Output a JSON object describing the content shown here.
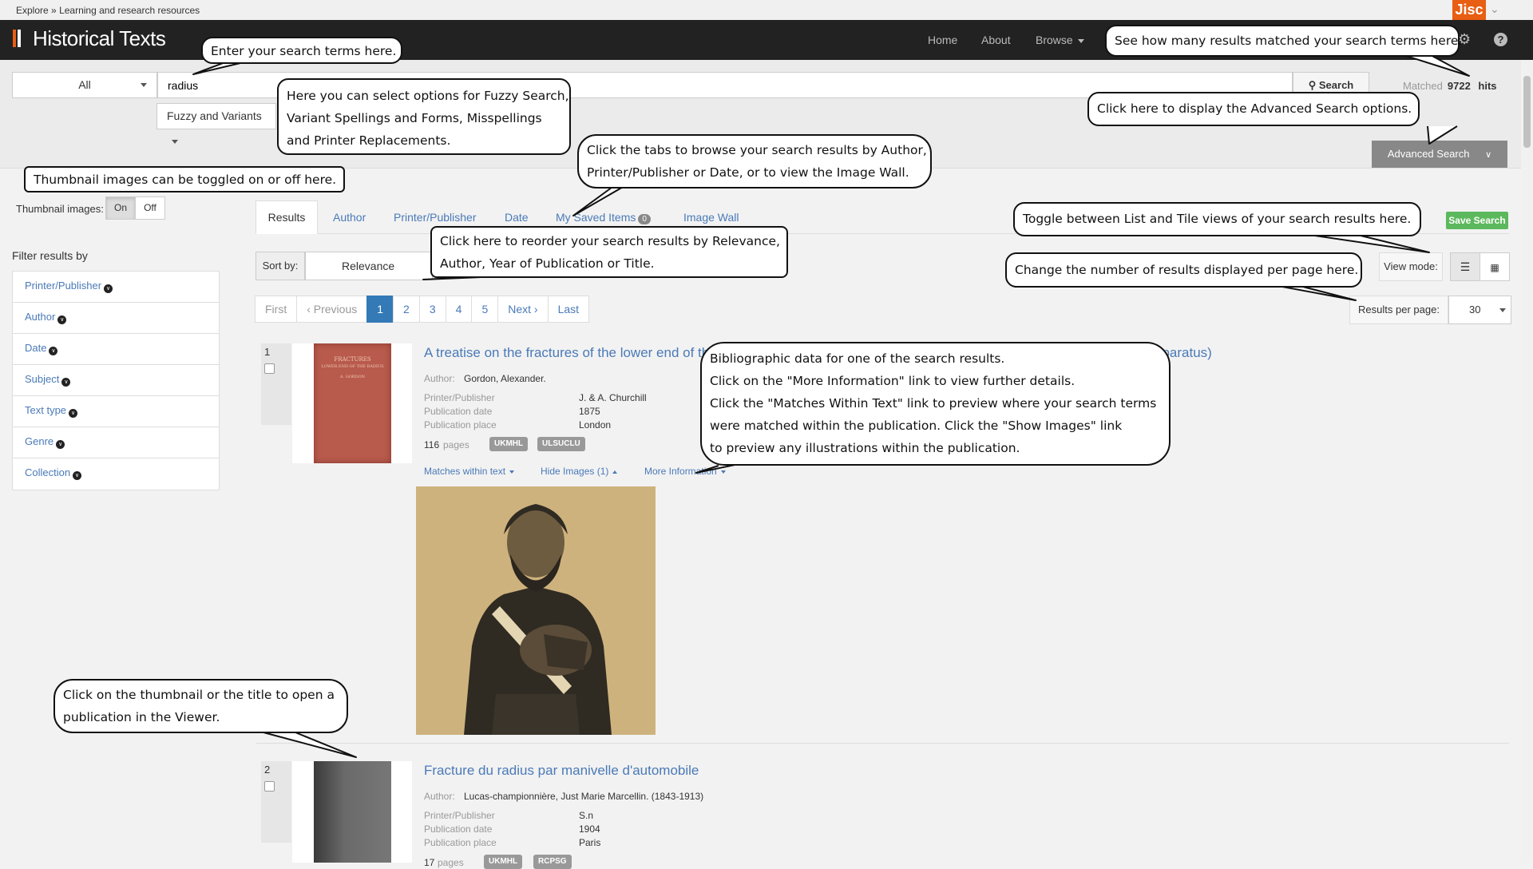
{
  "breadcrumb": {
    "explore": "Explore",
    "sep": "»",
    "current": "Learning and research resources"
  },
  "jisc": {
    "label": "Jisc"
  },
  "app": {
    "title": "Historical Texts"
  },
  "nav": {
    "home": "Home",
    "about": "About",
    "browse": "Browse"
  },
  "search": {
    "scope": "All",
    "query": "radius",
    "button": "Search",
    "fuzzy": "Fuzzy and Variants",
    "matched_label": "Matched",
    "matched_count": "9722",
    "hits_label": "hits",
    "advanced": "Advanced Search"
  },
  "thumbnails": {
    "label": "Thumbnail images:",
    "on": "On",
    "off": "Off"
  },
  "tabs": {
    "results": "Results",
    "author": "Author",
    "printer": "Printer/Publisher",
    "date": "Date",
    "saved": "My Saved Items",
    "saved_count": "0",
    "image_wall": "Image Wall"
  },
  "save_search": "Save Search",
  "filters": {
    "title": "Filter results by",
    "items": [
      {
        "label": "Printer/Publisher"
      },
      {
        "label": "Author"
      },
      {
        "label": "Date"
      },
      {
        "label": "Subject"
      },
      {
        "label": "Text type"
      },
      {
        "label": "Genre"
      },
      {
        "label": "Collection"
      }
    ]
  },
  "sort": {
    "label": "Sort by:",
    "value": "Relevance"
  },
  "view_mode": {
    "label": "View mode:"
  },
  "results_per_page": {
    "label": "Results per page:",
    "value": "30"
  },
  "pagination": {
    "first": "First",
    "prev": "‹ Previous",
    "pages": [
      "1",
      "2",
      "3",
      "4",
      "5"
    ],
    "current": "1",
    "next": "Next ›",
    "last": "Last"
  },
  "results": [
    {
      "number": "1",
      "title": "A treatise on the fractures of the lower end of th",
      "title_tail": "pparatus)",
      "author_label": "Author:",
      "author": "Gordon, Alexander.",
      "printer_label": "Printer/Publisher",
      "printer": "J. & A. Churchill",
      "date_label": "Publication date",
      "date": "1875",
      "place_label": "Publication place",
      "place": "London",
      "pages_count": "116",
      "pages_label": "pages",
      "badges": [
        "UKMHL",
        "ULSUCLU"
      ],
      "matches_link": "Matches within text",
      "images_link": "Hide Images (1)",
      "more_link": "More Information",
      "cover_title": "FRACTURES",
      "cover_sub": "LOWER END OF THE RADIUS",
      "cover_author": "A. GORDON"
    },
    {
      "number": "2",
      "title": "Fracture du radius par manivelle d'automobile",
      "author_label": "Author:",
      "author": "Lucas-championnière, Just Marie Marcellin. (1843-1913)",
      "printer_label": "Printer/Publisher",
      "printer": "S.n",
      "date_label": "Publication date",
      "date": "1904",
      "place_label": "Publication place",
      "place": "Paris",
      "pages_count": "17",
      "pages_label": "pages",
      "badges": [
        "UKMHL",
        "RCPSG"
      ]
    }
  ],
  "callouts": {
    "search_terms": "Enter your search terms here.",
    "hits": "See how many results matched your search terms here.",
    "fuzzy": [
      "Here you can select options for Fuzzy Search,",
      "Variant Spellings and Forms, Misspellings",
      " and Printer Replacements."
    ],
    "advanced": "Click here to display the Advanced Search options.",
    "thumbnails": "Thumbnail images can be toggled on or off here.",
    "tabs": [
      "Click the tabs to browse your search results by Author,",
      "Printer/Publisher or Date, or to view the Image Wall."
    ],
    "view_toggle": "Toggle between List and Tile views of your search results here.",
    "sort": [
      "Click here to reorder your search results by Relevance,",
      "Author, Year of Publication or Title."
    ],
    "per_page": "Change the number of results displayed per page here.",
    "biblio": [
      "Bibliographic data for one of the search results.",
      "Click on the \"More Information\" link to view further details.",
      "Click the \"Matches Within Text\" link to preview where your search terms",
      "were matched within the publication. Click the \"Show Images\" link",
      "to preview any illustrations within the publication."
    ],
    "thumbnail_open": [
      "Click on the thumbnail or the title to open a",
      "publication in the Viewer."
    ]
  },
  "colors": {
    "navbar": "#222222",
    "accent_orange": "#e85e13",
    "link": "#4a7ab8",
    "active_page": "#337ab7",
    "save_green": "#5cb85c"
  },
  "icons": [
    "search-icon",
    "gear-icon",
    "help-icon",
    "list-view-icon",
    "tile-view-icon"
  ]
}
